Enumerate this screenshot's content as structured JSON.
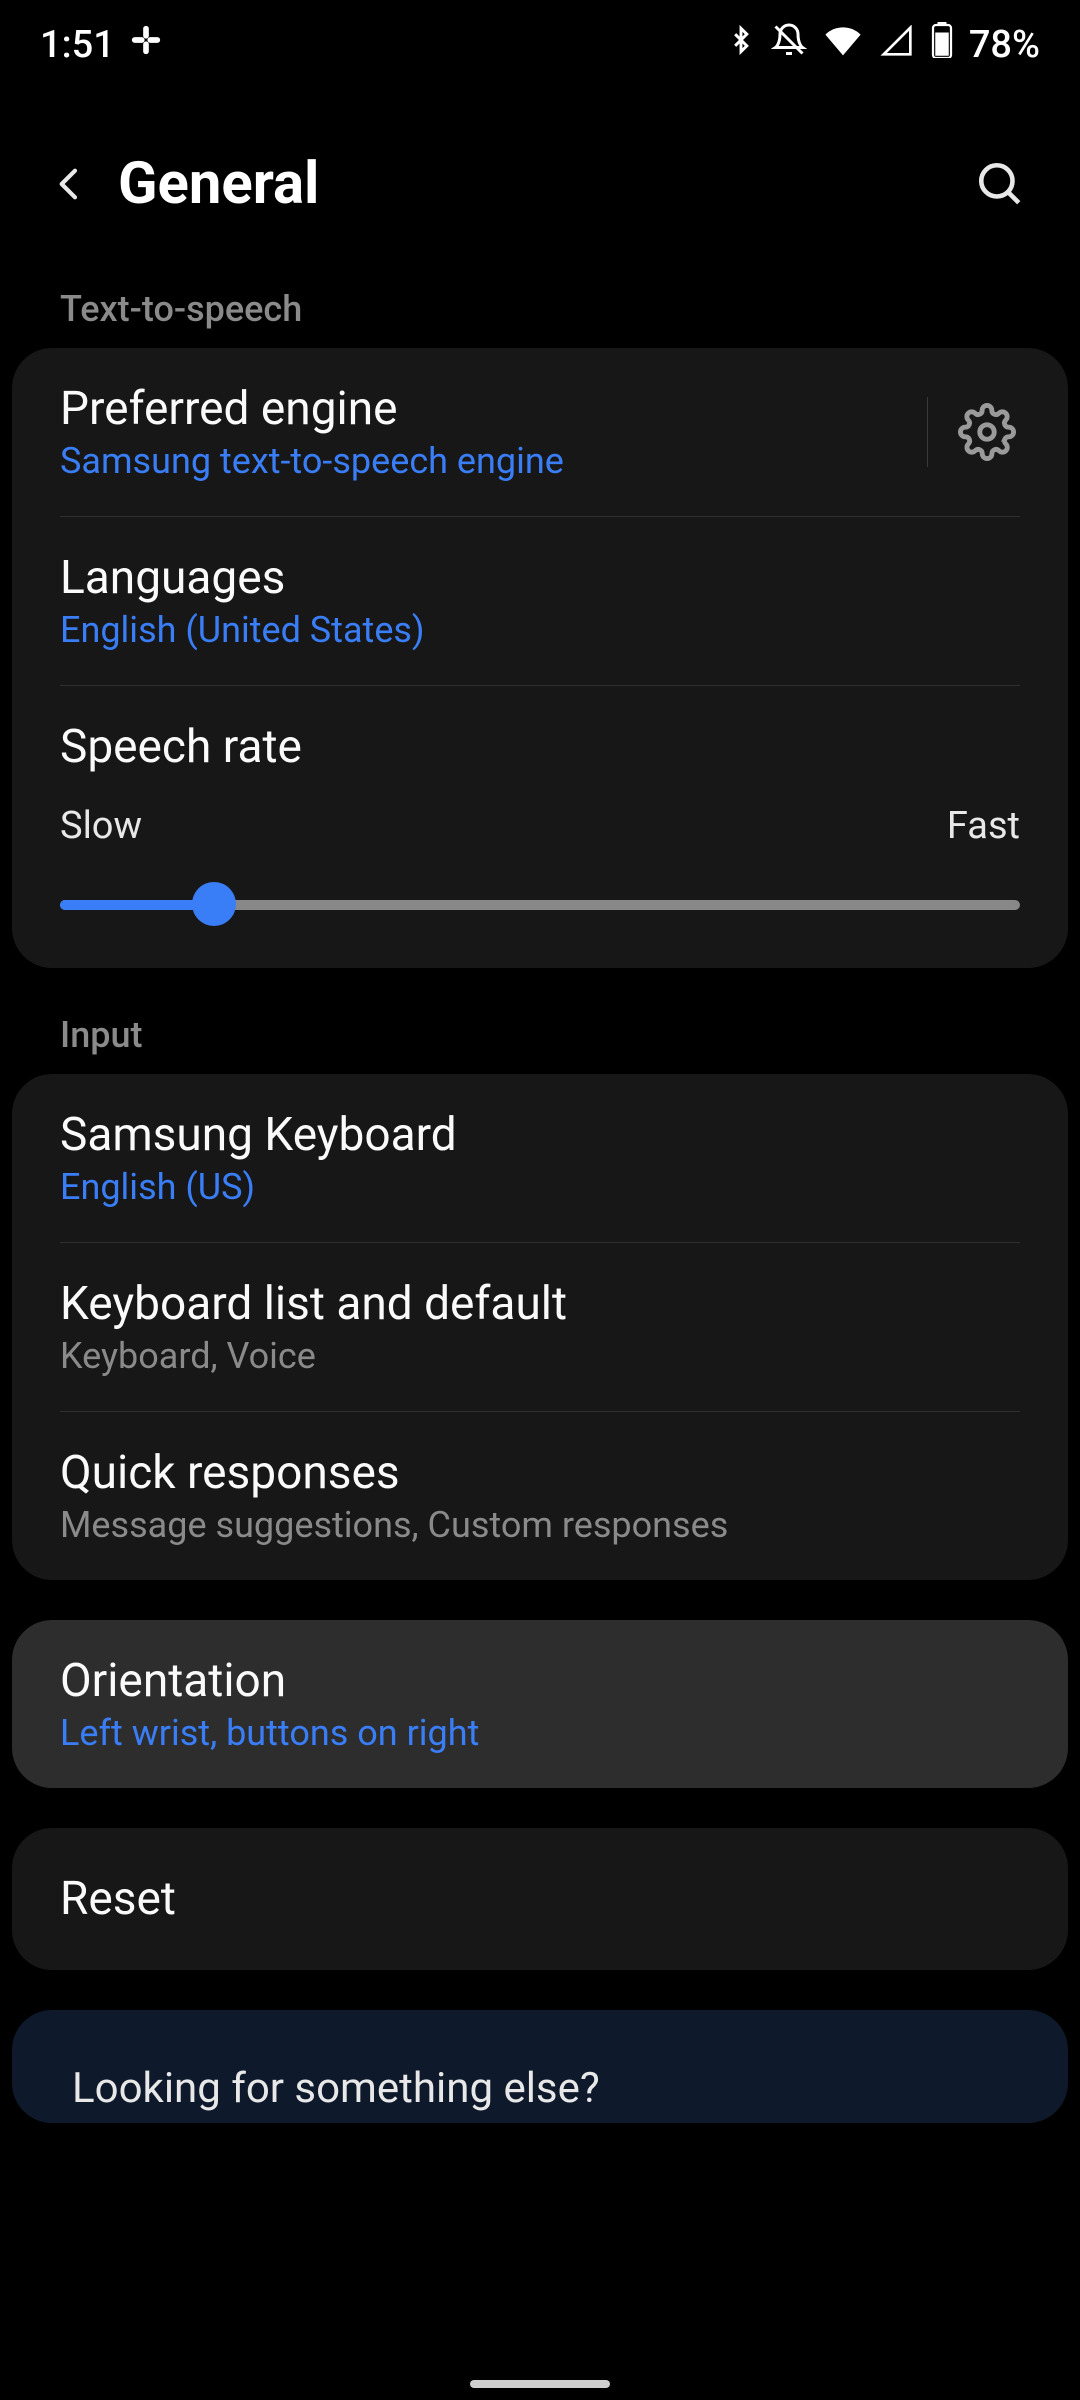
{
  "status": {
    "time": "1:51",
    "battery": "78%"
  },
  "header": {
    "title": "General"
  },
  "sections": {
    "tts_header": "Text-to-speech",
    "input_header": "Input"
  },
  "tts": {
    "preferred_engine": {
      "title": "Preferred engine",
      "value": "Samsung text-to-speech engine"
    },
    "languages": {
      "title": "Languages",
      "value": "English (United States)"
    },
    "speech_rate": {
      "title": "Speech rate",
      "slow_label": "Slow",
      "fast_label": "Fast",
      "percent": 16
    }
  },
  "input": {
    "keyboard": {
      "title": "Samsung Keyboard",
      "value": "English (US)"
    },
    "list_default": {
      "title": "Keyboard list and default",
      "value": "Keyboard, Voice"
    },
    "quick_responses": {
      "title": "Quick responses",
      "value": "Message suggestions, Custom responses"
    }
  },
  "orientation": {
    "title": "Orientation",
    "value": "Left wrist, buttons on right"
  },
  "reset": {
    "title": "Reset"
  },
  "footer": {
    "prompt": "Looking for something else?"
  }
}
